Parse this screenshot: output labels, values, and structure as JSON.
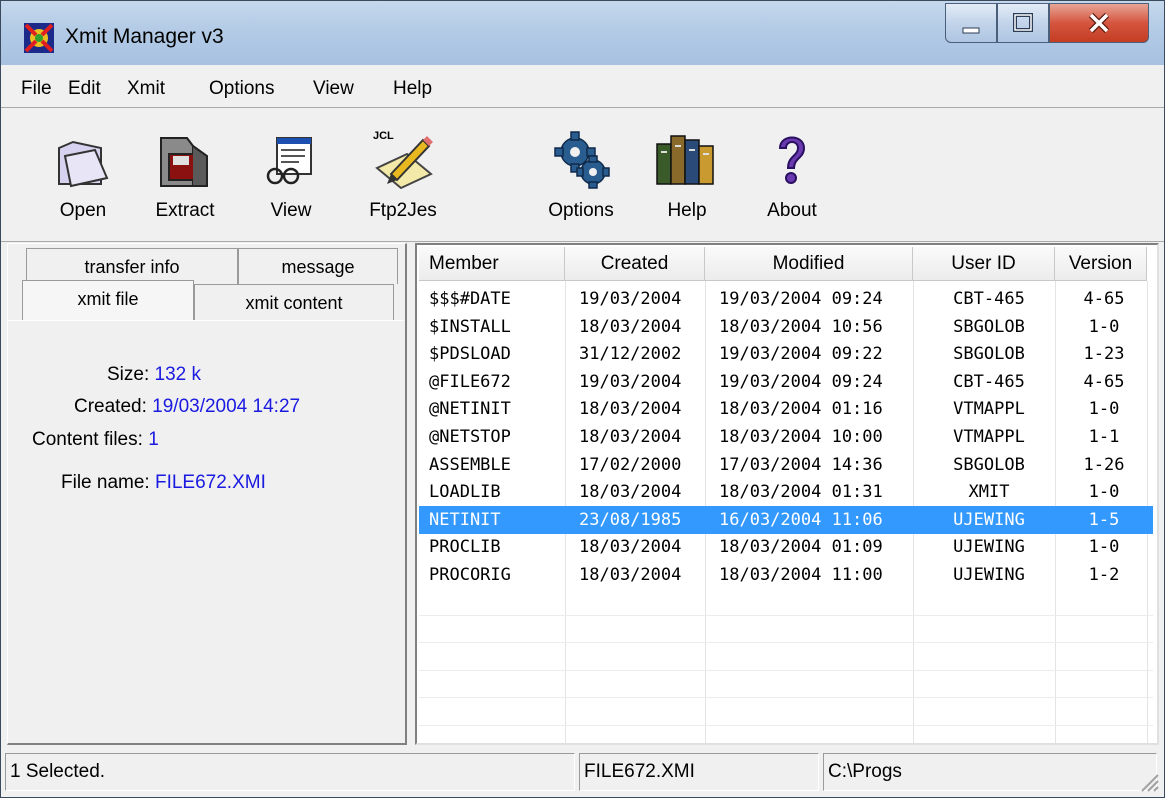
{
  "window": {
    "title": "Xmit Manager  v3"
  },
  "menu": [
    "File",
    "Edit",
    "Xmit",
    "Options",
    "View",
    "Help"
  ],
  "toolbar": [
    {
      "label": "Open",
      "icon": "folder-open-icon"
    },
    {
      "label": "Extract",
      "icon": "extract-disk-icon"
    },
    {
      "label": "View",
      "icon": "view-document-icon"
    },
    {
      "label": "Ftp2Jes",
      "icon": "jcl-pencil-icon"
    },
    {
      "label": "Options",
      "icon": "gear-icon"
    },
    {
      "label": "Help",
      "icon": "books-icon"
    },
    {
      "label": "About",
      "icon": "question-mark-icon"
    }
  ],
  "tabs": {
    "row1": [
      "transfer info",
      "message"
    ],
    "row2": [
      "xmit file",
      "xmit content"
    ],
    "active": "xmit file"
  },
  "info": {
    "size_label": "Size:",
    "size_value": "132 k",
    "created_label": "Created:",
    "created_value": "19/03/2004  14:27",
    "content_label": "Content files:",
    "content_value": "1",
    "filename_label": "File name:",
    "filename_value": "FILE672.XMI"
  },
  "table": {
    "columns": [
      "Member",
      "Created",
      "Modified",
      "User ID",
      "Version"
    ],
    "rows": [
      [
        "$$$#DATE",
        "19/03/2004",
        "19/03/2004  09:24",
        "CBT-465",
        "4-65"
      ],
      [
        "$INSTALL",
        "18/03/2004",
        "18/03/2004  10:56",
        "SBGOLOB",
        "1-0"
      ],
      [
        "$PDSLOAD",
        "31/12/2002",
        "19/03/2004  09:22",
        "SBGOLOB",
        "1-23"
      ],
      [
        "@FILE672",
        "19/03/2004",
        "19/03/2004  09:24",
        "CBT-465",
        "4-65"
      ],
      [
        "@NETINIT",
        "18/03/2004",
        "18/03/2004  01:16",
        "VTMAPPL",
        "1-0"
      ],
      [
        "@NETSTOP",
        "18/03/2004",
        "18/03/2004  10:00",
        "VTMAPPL",
        "1-1"
      ],
      [
        "ASSEMBLE",
        "17/02/2000",
        "17/03/2004  14:36",
        "SBGOLOB",
        "1-26"
      ],
      [
        "LOADLIB",
        "18/03/2004",
        "18/03/2004  01:31",
        "XMIT",
        "1-0"
      ],
      [
        "NETINIT",
        "23/08/1985",
        "16/03/2004  11:06",
        "UJEWING",
        "1-5"
      ],
      [
        "PROCLIB",
        "18/03/2004",
        "18/03/2004  01:09",
        "UJEWING",
        "1-0"
      ],
      [
        "PROCORIG",
        "18/03/2004",
        "18/03/2004  11:00",
        "UJEWING",
        "1-2"
      ]
    ],
    "selected_member": "NETINIT"
  },
  "status": {
    "selection": "1 Selected.",
    "file": "FILE672.XMI",
    "path": "C:\\Progs"
  },
  "colors": {
    "selection": "#3399ff",
    "value_text": "#1a1ae0",
    "title_bar": "#b3cbe6",
    "close_button": "#c43d23"
  }
}
